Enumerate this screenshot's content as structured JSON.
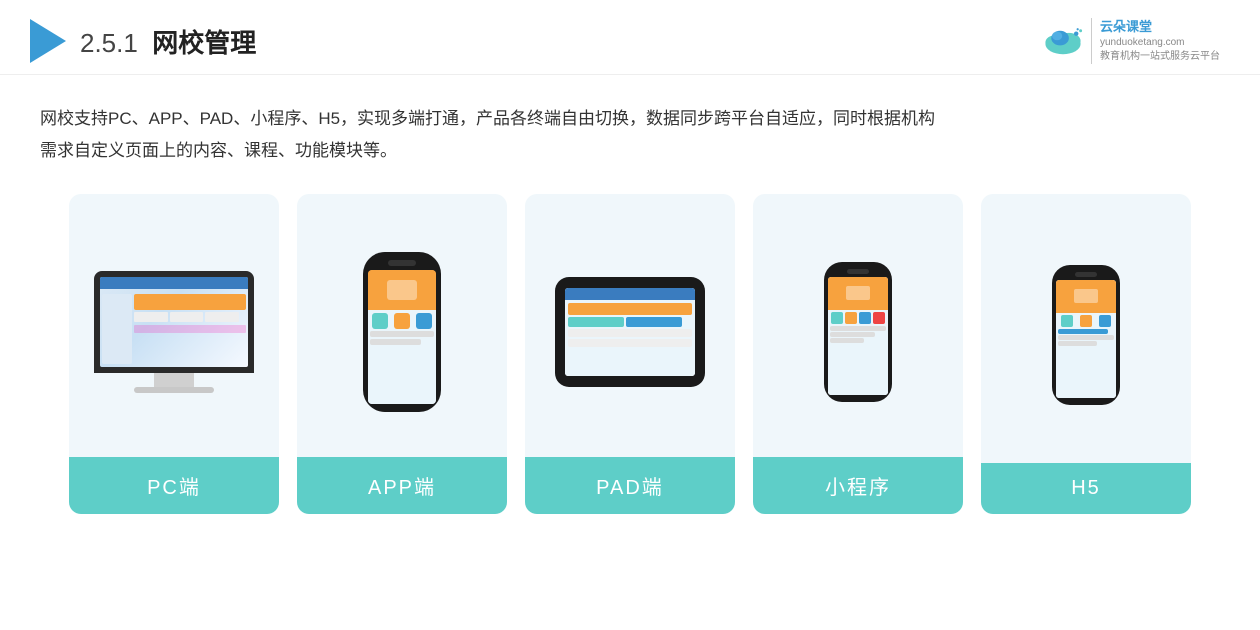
{
  "header": {
    "section_number": "2.5.1",
    "title_bold": "网校管理",
    "brand_url": "yunduoketang.com",
    "brand_tagline1": "教育机构一站",
    "brand_tagline2": "式服务云平台"
  },
  "description": {
    "line1": "网校支持PC、APP、PAD、小程序、H5，实现多端打通，产品各终端自由切换，数据同步跨平台自适应，同时根据机构",
    "line2": "需求自定义页面上的内容、课程、功能模块等。"
  },
  "cards": [
    {
      "id": "pc",
      "label": "PC端",
      "device": "pc"
    },
    {
      "id": "app",
      "label": "APP端",
      "device": "phone"
    },
    {
      "id": "pad",
      "label": "PAD端",
      "device": "tablet"
    },
    {
      "id": "mini",
      "label": "小程序",
      "device": "phone_small"
    },
    {
      "id": "h5",
      "label": "H5",
      "device": "phone_small2"
    }
  ]
}
